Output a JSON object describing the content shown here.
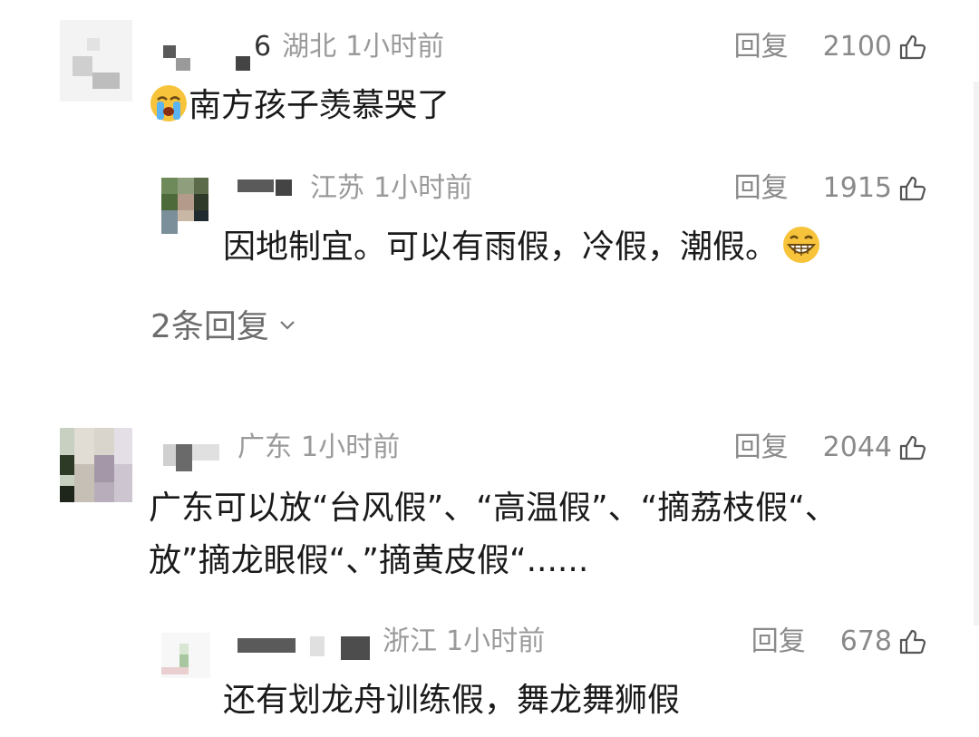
{
  "comments": [
    {
      "name_suffix": "6",
      "location": "湖北",
      "time": "1小时前",
      "reply_label": "回复",
      "likes": "2100",
      "text": "南方孩子羡慕哭了",
      "emoji_icon": "crying-face-icon"
    },
    {
      "location": "江苏",
      "time": "1小时前",
      "reply_label": "回复",
      "likes": "1915",
      "text": "因地制宜。可以有雨假，冷假，潮假。",
      "emoji_icon": "grinning-face-icon"
    },
    {
      "location": "广东",
      "time": "1小时前",
      "reply_label": "回复",
      "likes": "2044",
      "text_line1": "广东可以放“台风假”、“高温假”、“摘荔枝假“、",
      "text_line2": "放”摘龙眼假“、”摘黄皮假“......"
    },
    {
      "location": "浙江",
      "time": "1小时前",
      "reply_label": "回复",
      "likes": "678",
      "text": "还有划龙舟训练假，舞龙舞狮假"
    }
  ],
  "more_replies": "2条回复"
}
